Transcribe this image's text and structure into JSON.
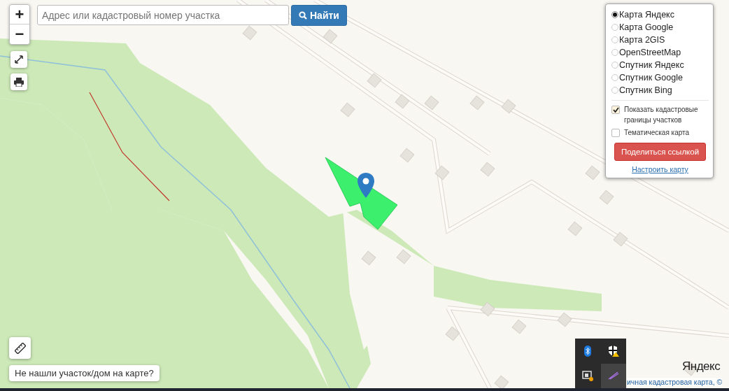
{
  "search": {
    "placeholder": "Адрес или кадастровый номер участка",
    "button": "Найти"
  },
  "zoom": {
    "in": "+",
    "out": "−"
  },
  "layers": {
    "options": [
      {
        "label": "Карта Яндекс",
        "selected": true
      },
      {
        "label": "Карта Google",
        "selected": false
      },
      {
        "label": "Карта 2GIS",
        "selected": false
      },
      {
        "label": "OpenStreetMap",
        "selected": false
      },
      {
        "label": "Спутник Яндекс",
        "selected": false
      },
      {
        "label": "Спутник Google",
        "selected": false
      },
      {
        "label": "Спутник Bing",
        "selected": false
      }
    ],
    "toggles": [
      {
        "label": "Показать кадастровые границы участков",
        "checked": true
      },
      {
        "label": "Тематическая карта",
        "checked": false
      }
    ],
    "share": "Поделиться ссылкой",
    "configure": "Настроить карту"
  },
  "not_found": "Не нашли участок/дом на карте?",
  "map": {
    "logo": "Яндекс",
    "attribution": "ичная кадастровая карта, ©"
  }
}
